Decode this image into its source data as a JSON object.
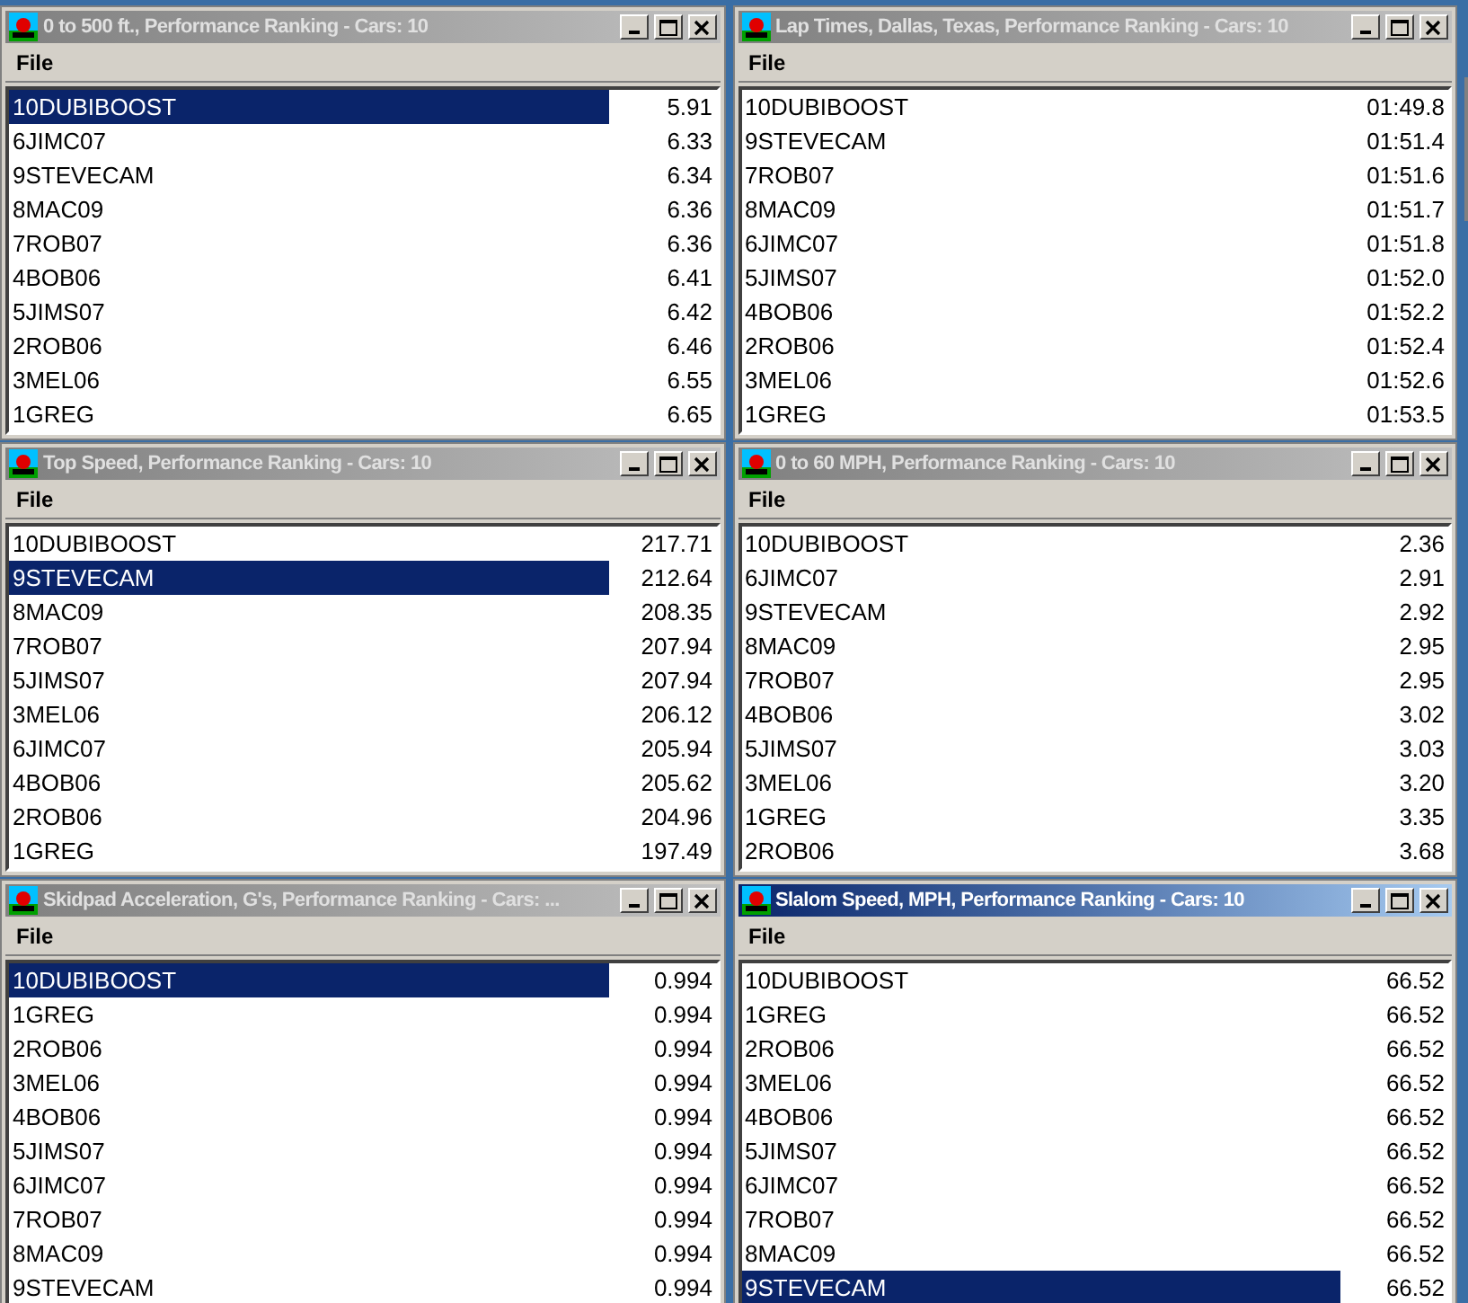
{
  "columns": [
    [
      {
        "title": "0 to 500 ft., Performance Ranking - Cars: 10",
        "active": false,
        "menu": [
          "File"
        ],
        "rows": [
          {
            "car": "10DUBIBOOST",
            "value": "5.91",
            "selected": true
          },
          {
            "car": "6JIMC07",
            "value": "6.33",
            "selected": false
          },
          {
            "car": "9STEVECAM",
            "value": "6.34",
            "selected": false
          },
          {
            "car": "8MAC09",
            "value": "6.36",
            "selected": false
          },
          {
            "car": "7ROB07",
            "value": "6.36",
            "selected": false
          },
          {
            "car": "4BOB06",
            "value": "6.41",
            "selected": false
          },
          {
            "car": "5JIMS07",
            "value": "6.42",
            "selected": false
          },
          {
            "car": "2ROB06",
            "value": "6.46",
            "selected": false
          },
          {
            "car": "3MEL06",
            "value": "6.55",
            "selected": false
          },
          {
            "car": "1GREG",
            "value": "6.65",
            "selected": false
          }
        ]
      },
      {
        "title": "Top Speed, Performance Ranking - Cars: 10",
        "active": false,
        "menu": [
          "File"
        ],
        "rows": [
          {
            "car": "10DUBIBOOST",
            "value": "217.71",
            "selected": false
          },
          {
            "car": "9STEVECAM",
            "value": "212.64",
            "selected": true
          },
          {
            "car": "8MAC09",
            "value": "208.35",
            "selected": false
          },
          {
            "car": "7ROB07",
            "value": "207.94",
            "selected": false
          },
          {
            "car": "5JIMS07",
            "value": "207.94",
            "selected": false
          },
          {
            "car": "3MEL06",
            "value": "206.12",
            "selected": false
          },
          {
            "car": "6JIMC07",
            "value": "205.94",
            "selected": false
          },
          {
            "car": "4BOB06",
            "value": "205.62",
            "selected": false
          },
          {
            "car": "2ROB06",
            "value": "204.96",
            "selected": false
          },
          {
            "car": "1GREG",
            "value": "197.49",
            "selected": false
          }
        ]
      },
      {
        "title": "Skidpad Acceleration, G's, Performance Ranking - Cars: ...",
        "active": false,
        "menu": [
          "File"
        ],
        "rows": [
          {
            "car": "10DUBIBOOST",
            "value": "0.994",
            "selected": true
          },
          {
            "car": "1GREG",
            "value": "0.994",
            "selected": false
          },
          {
            "car": "2ROB06",
            "value": "0.994",
            "selected": false
          },
          {
            "car": "3MEL06",
            "value": "0.994",
            "selected": false
          },
          {
            "car": "4BOB06",
            "value": "0.994",
            "selected": false
          },
          {
            "car": "5JIMS07",
            "value": "0.994",
            "selected": false
          },
          {
            "car": "6JIMC07",
            "value": "0.994",
            "selected": false
          },
          {
            "car": "7ROB07",
            "value": "0.994",
            "selected": false
          },
          {
            "car": "8MAC09",
            "value": "0.994",
            "selected": false
          },
          {
            "car": "9STEVECAM",
            "value": "0.994",
            "selected": false
          }
        ]
      }
    ],
    [
      {
        "title": "Lap Times, Dallas, Texas, Performance Ranking - Cars: 10",
        "active": false,
        "menu": [
          "File"
        ],
        "rows": [
          {
            "car": "10DUBIBOOST",
            "value": "01:49.8",
            "selected": false
          },
          {
            "car": "9STEVECAM",
            "value": "01:51.4",
            "selected": false
          },
          {
            "car": "7ROB07",
            "value": "01:51.6",
            "selected": false
          },
          {
            "car": "8MAC09",
            "value": "01:51.7",
            "selected": false
          },
          {
            "car": "6JIMC07",
            "value": "01:51.8",
            "selected": false
          },
          {
            "car": "5JIMS07",
            "value": "01:52.0",
            "selected": false
          },
          {
            "car": "4BOB06",
            "value": "01:52.2",
            "selected": false
          },
          {
            "car": "2ROB06",
            "value": "01:52.4",
            "selected": false
          },
          {
            "car": "3MEL06",
            "value": "01:52.6",
            "selected": false
          },
          {
            "car": "1GREG",
            "value": "01:53.5",
            "selected": false
          }
        ]
      },
      {
        "title": "0 to 60 MPH, Performance Ranking - Cars: 10",
        "active": false,
        "menu": [
          "File"
        ],
        "rows": [
          {
            "car": "10DUBIBOOST",
            "value": "2.36",
            "selected": false
          },
          {
            "car": "6JIMC07",
            "value": "2.91",
            "selected": false
          },
          {
            "car": "9STEVECAM",
            "value": "2.92",
            "selected": false
          },
          {
            "car": "8MAC09",
            "value": "2.95",
            "selected": false
          },
          {
            "car": "7ROB07",
            "value": "2.95",
            "selected": false
          },
          {
            "car": "4BOB06",
            "value": "3.02",
            "selected": false
          },
          {
            "car": "5JIMS07",
            "value": "3.03",
            "selected": false
          },
          {
            "car": "3MEL06",
            "value": "3.20",
            "selected": false
          },
          {
            "car": "1GREG",
            "value": "3.35",
            "selected": false
          },
          {
            "car": "2ROB06",
            "value": "3.68",
            "selected": false
          }
        ]
      },
      {
        "title": "Slalom Speed, MPH, Performance Ranking - Cars: 10",
        "active": true,
        "menu": [
          "File"
        ],
        "rows": [
          {
            "car": "10DUBIBOOST",
            "value": "66.52",
            "selected": false
          },
          {
            "car": "1GREG",
            "value": "66.52",
            "selected": false
          },
          {
            "car": "2ROB06",
            "value": "66.52",
            "selected": false
          },
          {
            "car": "3MEL06",
            "value": "66.52",
            "selected": false
          },
          {
            "car": "4BOB06",
            "value": "66.52",
            "selected": false
          },
          {
            "car": "5JIMS07",
            "value": "66.52",
            "selected": false
          },
          {
            "car": "6JIMC07",
            "value": "66.52",
            "selected": false
          },
          {
            "car": "7ROB07",
            "value": "66.52",
            "selected": false
          },
          {
            "car": "8MAC09",
            "value": "66.52",
            "selected": false
          },
          {
            "car": "9STEVECAM",
            "value": "66.52",
            "selected": true
          }
        ]
      }
    ]
  ]
}
